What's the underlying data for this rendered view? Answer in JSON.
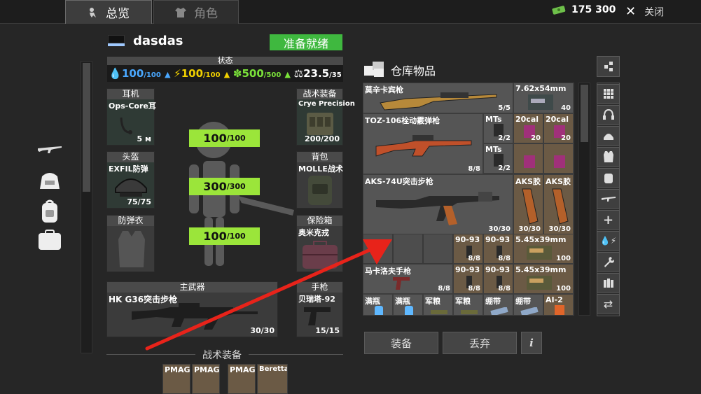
{
  "tabs": [
    {
      "label": "总览"
    },
    {
      "label": "角色"
    }
  ],
  "header": {
    "money": "175 300",
    "close_label": "关闭"
  },
  "colors": {
    "accent_green": "#9be53a",
    "ready_green": "#3fb83f",
    "water_blue": "#4aa8ff",
    "energy_yellow": "#f0d000",
    "health_green": "#7be33a"
  },
  "character": {
    "name": "dasdas",
    "status_badge": "准备就绪",
    "status_label": "状态"
  },
  "stats": [
    {
      "icon": "water-drop-icon",
      "value": "100",
      "max": "/100"
    },
    {
      "icon": "energy-bolt-icon",
      "value": "100",
      "max": "/100"
    },
    {
      "icon": "health-icon",
      "value": "500",
      "max": "/500"
    },
    {
      "icon": "weight-icon",
      "value": "23.5",
      "max": "/35"
    }
  ],
  "equipment": {
    "headset": {
      "header": "耳机",
      "name": "Ops-Core耳",
      "count": "5 м"
    },
    "helmet": {
      "header": "头盔",
      "name": "EXFIL防弹",
      "count": "75/75"
    },
    "armor": {
      "header": "防弹衣",
      "name": "",
      "count": ""
    },
    "tactical_rig": {
      "header": "战术装备",
      "name": "Crye Precision",
      "count": "200/200"
    },
    "backpack": {
      "header": "背包",
      "name": "MOLLE战术",
      "count": ""
    },
    "safe_box": {
      "header": "保险箱",
      "name": "奥米克戎",
      "count": ""
    },
    "primary": {
      "header": "主武器",
      "name": "HK G36突击步枪",
      "count": "30/30"
    },
    "pistol": {
      "header": "手枪",
      "name": "贝瑞塔-92",
      "count": "15/15"
    }
  },
  "durability": [
    {
      "value": "100",
      "max": "/100"
    },
    {
      "value": "300",
      "max": "/300"
    },
    {
      "value": "100",
      "max": "/100"
    }
  ],
  "tactical_section": {
    "label": "战术装备",
    "items": [
      "PMAG",
      "PMAG",
      "PMAG",
      "Beretta"
    ]
  },
  "storage": {
    "title": "仓库物品",
    "equip_button": "装备",
    "discard_button": "丢弃",
    "info_button": "i",
    "items": {
      "mosin": {
        "name": "莫辛卡宾枪",
        "qty": "5/5"
      },
      "ammo762": {
        "name": "7.62x54mm",
        "qty": "40"
      },
      "toz": {
        "name": "TOZ-106栓动霰弹枪",
        "qty": "8/8"
      },
      "mts1": {
        "name": "MTs",
        "qty": "2/2"
      },
      "mts2": {
        "name": "MTs",
        "qty": "2/2"
      },
      "cal20a": {
        "name": "20cal",
        "qty": "20"
      },
      "cal20b": {
        "name": "20cal",
        "qty": "20"
      },
      "aks74u": {
        "name": "AKS-74U突击步枪",
        "qty": "30/30"
      },
      "aksmag1": {
        "name": "AKS胶",
        "qty": "30/30"
      },
      "aksmag2": {
        "name": "AKS胶",
        "qty": "30/30"
      },
      "mag9093a": {
        "name": "90-93",
        "qty": "8/8"
      },
      "mag9093b": {
        "name": "90-93",
        "qty": "8/8"
      },
      "ammo545a": {
        "name": "5.45x39mm",
        "qty": "100"
      },
      "makarov": {
        "name": "马卡洛夫手枪",
        "qty": "8/8"
      },
      "mag9093c": {
        "name": "90-93",
        "qty": "8/8"
      },
      "mag9093d": {
        "name": "90-93",
        "qty": "8/8"
      },
      "ammo545b": {
        "name": "5.45x39mm",
        "qty": "100"
      },
      "water1": {
        "name": "满瓶"
      },
      "water2": {
        "name": "满瓶"
      },
      "ration1": {
        "name": "军粮"
      },
      "ration2": {
        "name": "军粮"
      },
      "bandage1": {
        "name": "绷带"
      },
      "bandage2": {
        "name": "绷带"
      },
      "ai2": {
        "name": "AI-2"
      }
    }
  },
  "right_filters": [
    "all-grid-icon",
    "headset-icon",
    "helmet-icon",
    "armor-icon",
    "backpack-icon",
    "rifle-icon",
    "medical-cross-icon",
    "water-energy-icon",
    "wrench-icon",
    "ammo-icon",
    "swap-icon"
  ]
}
